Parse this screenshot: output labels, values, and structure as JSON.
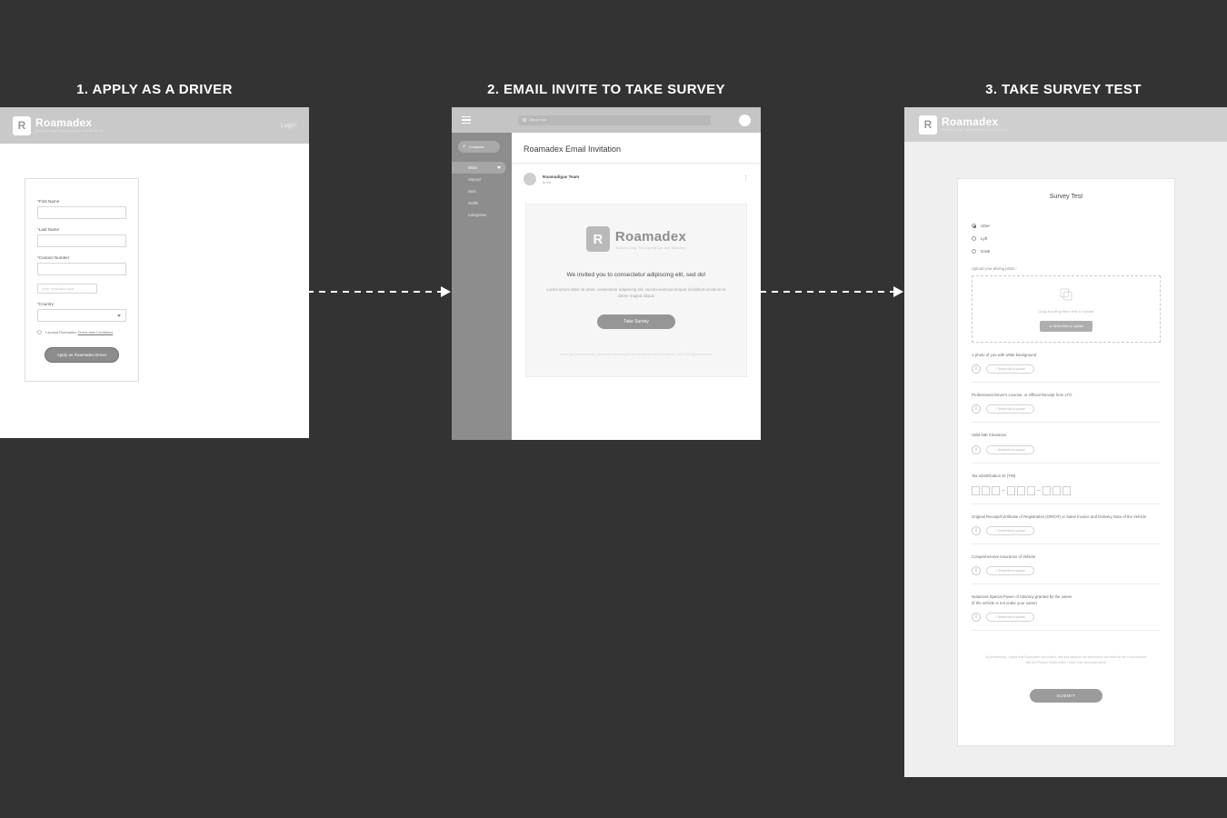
{
  "steps": [
    {
      "title": "1. APPLY AS A DRIVER"
    },
    {
      "title": "2. EMAIL INVITE TO TAKE SURVEY"
    },
    {
      "title": "3. TAKE SURVEY TEST"
    }
  ],
  "brand": {
    "name": "Roamadex",
    "tagline": "Modernizing Transportation and Mobility",
    "mark": "R"
  },
  "apply": {
    "login_label": "Login",
    "fields": [
      {
        "label": "*First Name",
        "value": "",
        "type": "text"
      },
      {
        "label": "*Last Name",
        "value": "",
        "type": "text"
      },
      {
        "label": "*Contact Number",
        "value": "",
        "type": "text"
      }
    ],
    "verify": {
      "placeholder": "Enter verification code",
      "value": ""
    },
    "country": {
      "label": "*Country",
      "selected": ""
    },
    "terms": {
      "prefix": "I accept Roamadex ",
      "link": "Terms and Conditions"
    },
    "submit_label": "Apply as Roamadex Driver"
  },
  "email": {
    "search_placeholder": "Search mail",
    "compose_label": "Compose",
    "nav": [
      {
        "label": "Inbox",
        "active": true
      },
      {
        "label": "Starred",
        "active": false
      },
      {
        "label": "Sent",
        "active": false
      },
      {
        "label": "Drafts",
        "active": false
      },
      {
        "label": "Categories",
        "active": false
      }
    ],
    "subject": "Roamadex Email Invitation",
    "sender": "Roamadigas Team",
    "to": "to me",
    "headline": "We invited you to consectetur adipiscing elit, sed do!",
    "paragraph": "Lorem ipsum dolor sit amet, consectetur adipiscing elit, sed do eiusmod tempor incididunt ut labore et dolore magna aliqua.",
    "cta_label": "Take Survey",
    "footer": "Lorem ipsum dolor sit amet, consectetur adipiscing elit, sed do eiusmod tempor incididunt. 2022 © All Rights Reserved."
  },
  "survey": {
    "title": "Survey Test",
    "platforms": [
      {
        "label": "Uber",
        "selected": true
      },
      {
        "label": "Lyft",
        "selected": false
      },
      {
        "label": "Grab",
        "selected": false
      }
    ],
    "upload_label": "Upload your driving photo :",
    "dropzone_text": "Drag and drop files here to Upload",
    "dropzone_button": "or Select files to upload",
    "documents": [
      {
        "label": "A photo of you with white background",
        "sub": "",
        "button": "+ Select file to upload",
        "input": "upload"
      },
      {
        "label": "Professional Driver's License, or Official Receipt from LTO",
        "sub": "",
        "button": "+ Select file to upload",
        "input": "upload"
      },
      {
        "label": "Valid NBI Clearance",
        "sub": "",
        "button": "+ Select file to upload",
        "input": "upload"
      },
      {
        "label": "Tax Identification ID (TIN)",
        "sub": "",
        "button": "",
        "input": "tin"
      },
      {
        "label": "Original Receipt/Certificate of Registration (OR/CR) or Sales Invoice and Delivery Note of the Vehicle",
        "sub": "",
        "button": "+ Select file to upload",
        "input": "upload"
      },
      {
        "label": "Comprehensive Insurance of Vehicle",
        "sub": "",
        "button": "+ Select file to upload",
        "input": "upload"
      },
      {
        "label": "Notarized Special Power of Attorney granted by the owner",
        "sub": "(if the vehicle is not under your name)",
        "button": "+ Select file to upload",
        "input": "upload"
      }
    ],
    "privacy": "By proceeding, I agree that Roamadex can collect, use and disclose the information provided by me in accordance with the Privacy Policy which I have read and understand.",
    "submit_label": "SUBMIT"
  },
  "colors": {
    "background": "#333333",
    "panel": "#ffffff",
    "header_gray": "#c9c9c9",
    "accent_gray": "#8c8c8c"
  }
}
